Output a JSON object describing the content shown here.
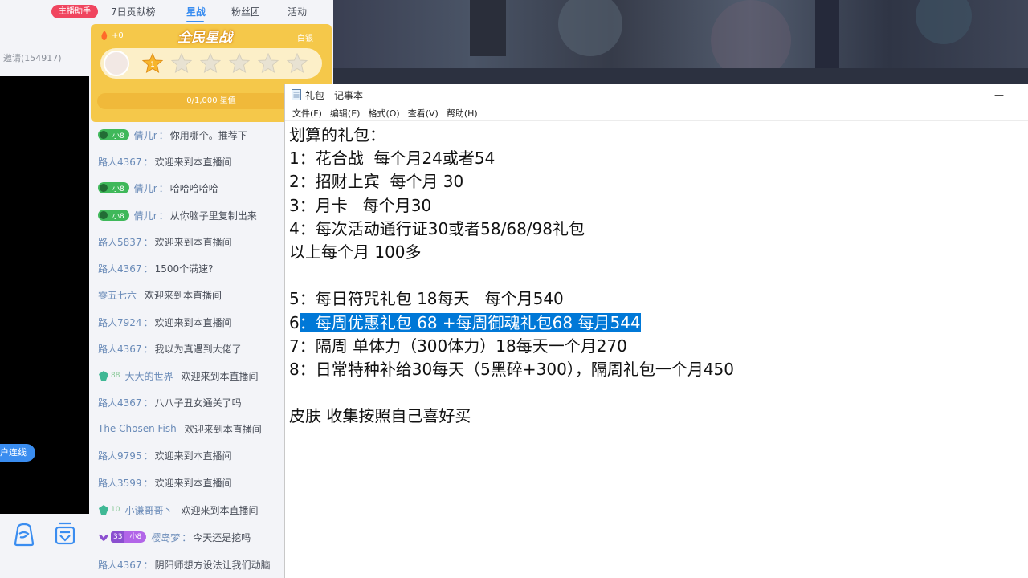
{
  "left": {
    "invite_text": "邀请(154917)",
    "connect_button": "户连线"
  },
  "tabs": {
    "host_helper": "主播助手",
    "items": [
      "7日贡献榜",
      "星战",
      "粉丝团",
      "活动"
    ],
    "active": "星战"
  },
  "star_panel": {
    "plus_value": "+0",
    "title": "全民星战",
    "tier": "白银",
    "current_star": "1",
    "progress_text": "0/1,000 星值",
    "stars_total": 6,
    "stars_active": 1
  },
  "chat": [
    {
      "badge": "fan",
      "badge_text": "小8",
      "user": "倩儿r",
      "message": "你用哪个。推荐下"
    },
    {
      "badge": "",
      "user": "路人4367",
      "message": "欢迎来到本直播间"
    },
    {
      "badge": "fan",
      "badge_text": "小8",
      "user": "倩儿r",
      "message": "哈哈哈哈哈"
    },
    {
      "badge": "fan",
      "badge_text": "小8",
      "user": "倩儿r",
      "message": "从你脑子里复制出来"
    },
    {
      "badge": "",
      "user": "路人5837",
      "message": "欢迎来到本直播间"
    },
    {
      "badge": "",
      "user": "路人4367",
      "message": "1500个满速?"
    },
    {
      "badge": "",
      "user": "零五七六",
      "message": "欢迎来到本直播间"
    },
    {
      "badge": "",
      "user": "路人7924",
      "message": "欢迎来到本直播间"
    },
    {
      "badge": "",
      "user": "路人4367",
      "message": "我以为真遇到大佬了"
    },
    {
      "badge": "gem",
      "badge_text": "88",
      "user": "大大的世界",
      "message": "欢迎来到本直播间"
    },
    {
      "badge": "",
      "user": "路人4367",
      "message": "八八子丑女通关了吗"
    },
    {
      "badge": "",
      "user": "The Chosen Fish",
      "message": "欢迎来到本直播间"
    },
    {
      "badge": "",
      "user": "路人9795",
      "message": "欢迎来到本直播间"
    },
    {
      "badge": "",
      "user": "路人3599",
      "message": "欢迎来到本直播间"
    },
    {
      "badge": "gem",
      "badge_text": "10",
      "user": "小谦哥哥丶",
      "message": "欢迎来到本直播间"
    },
    {
      "badge": "33",
      "badge_text": "小8",
      "badge_num": "33",
      "user": "樱岛梦",
      "message": "今天还是挖吗"
    },
    {
      "badge": "",
      "user": "路人4367",
      "message": "阴阳师想方设法让我们动脑"
    }
  ],
  "notepad": {
    "title": "礼包 - 记事本",
    "menus": [
      "文件(F)",
      "编辑(E)",
      "格式(O)",
      "查看(V)",
      "帮助(H)"
    ],
    "lines": [
      "划算的礼包：",
      "1：花合战  每个月24或者54",
      "2：招财上宾  每个月 30",
      "3：月卡   每个月30",
      "4：每次活动通行证30或者58/68/98礼包",
      "以上每个月 100多",
      "",
      "5：每日符咒礼包 18每天   每个月540",
      "6：每周优惠礼包 68 +每周御魂礼包68 每月544",
      "7：隔周 单体力（300体力）18每天一个月270",
      "8：日常特种补给30每天（5黑碎+300），隔周礼包一个月450",
      "",
      "皮肤 收集按照自己喜好买"
    ],
    "highlighted_line": 8
  },
  "colors": {
    "accent": "#3a8df0",
    "host_helper": "#f0455f",
    "star_panel": "#f5c84a",
    "selection": "#0078d7"
  },
  "icons": {
    "bottom_left": "bag-icon",
    "bottom_right": "shop-icon",
    "notepad_file": "notepad-file-icon",
    "minimize": "minimize-icon"
  }
}
